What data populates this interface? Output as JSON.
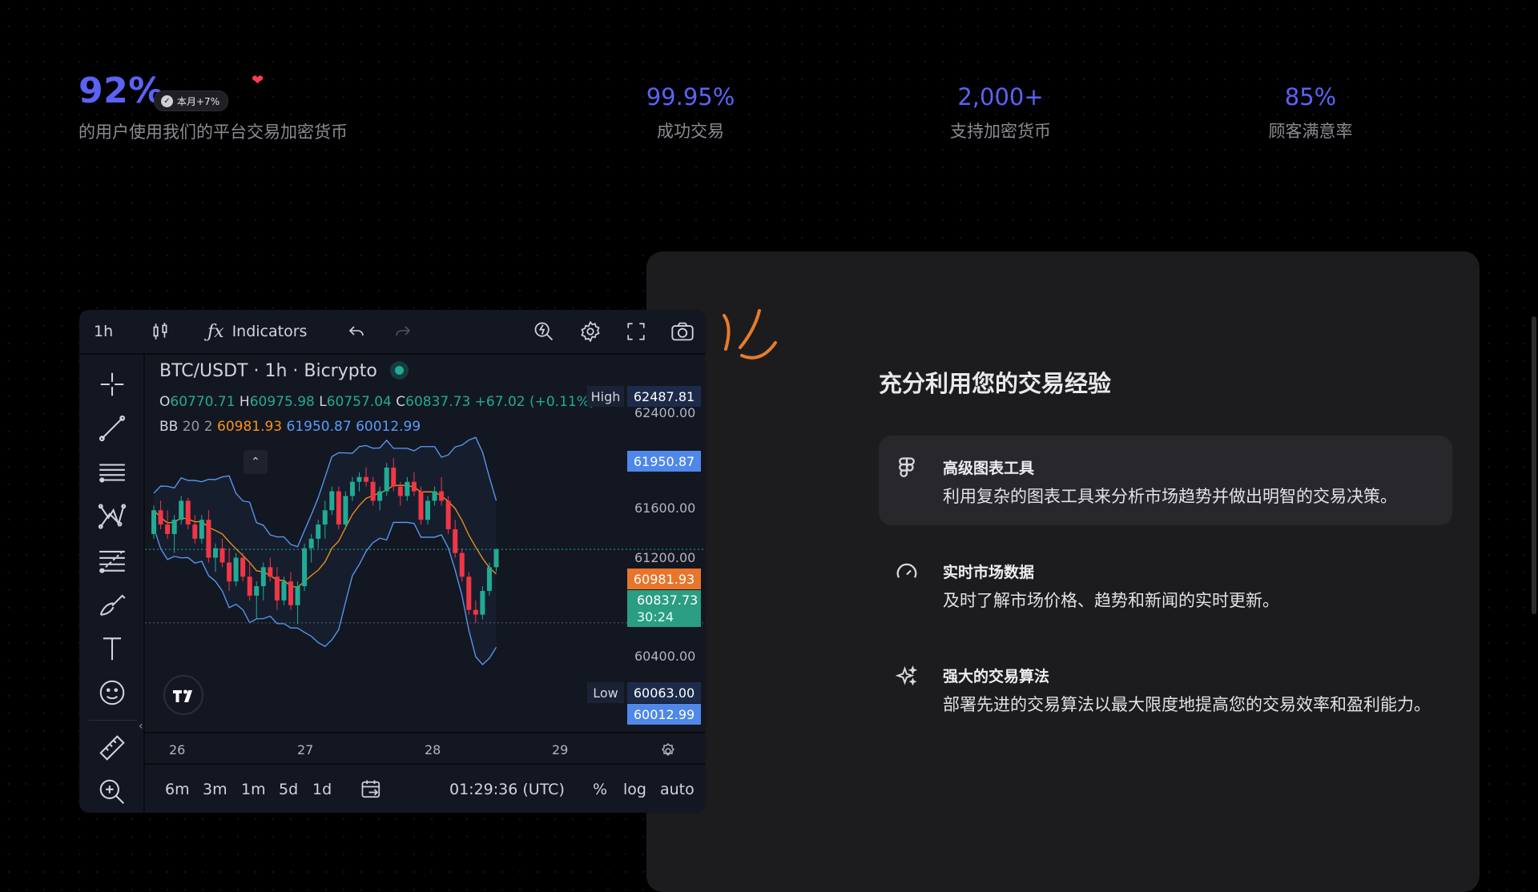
{
  "stats": {
    "main": {
      "value": "92%",
      "badge": "本月+7%",
      "label": "的用户使用我们的平台交易加密货币"
    },
    "items": [
      {
        "value": "99.95%",
        "label": "成功交易"
      },
      {
        "value": "2,000+",
        "label": "支持加密货币"
      },
      {
        "value": "85%",
        "label": "顾客满意率"
      }
    ]
  },
  "panel": {
    "title": "充分利用您的交易经验",
    "features": [
      {
        "title": "高级图表工具",
        "desc": "利用复杂的图表工具来分析市场趋势并做出明智的交易决策。",
        "icon": "figma-icon"
      },
      {
        "title": "实时市场数据",
        "desc": "及时了解市场价格、趋势和新闻的实时更新。",
        "icon": "gauge-icon"
      },
      {
        "title": "强大的交易算法",
        "desc": "部署先进的交易算法以最大限度地提高您的交易效率和盈利能力。",
        "icon": "sparkles-icon"
      }
    ]
  },
  "chart_widget": {
    "interval": "1h",
    "indicators_label": "Indicators",
    "symbol": "BTC/USDT · 1h · Bicrypto",
    "ohlc": {
      "o_label": "O",
      "o": "60770.71",
      "h_label": "H",
      "h": "60975.98",
      "l_label": "L",
      "l": "60757.04",
      "c_label": "C",
      "c": "60837.73",
      "change": "+67.02 (+0.11%)"
    },
    "bb": {
      "label": "BB",
      "params": "20 2",
      "basis": "60981.93",
      "upper": "61950.87",
      "lower": "60012.99"
    },
    "price_axis": [
      "62400.00",
      "61600.00",
      "61200.00",
      "60400.00"
    ],
    "tags": {
      "high_label": "High",
      "high": "62487.81",
      "upper": "61950.87",
      "basis": "60981.93",
      "last": "60837.73",
      "countdown": "30:24",
      "low_label": "Low",
      "low": "60063.00",
      "lower": "60012.99"
    },
    "time_axis": [
      "26",
      "27",
      "28",
      "29"
    ],
    "ranges": [
      "6m",
      "3m",
      "1m",
      "5d",
      "1d"
    ],
    "clock": "01:29:36 (UTC)",
    "scale_options": [
      "%",
      "log",
      "auto"
    ],
    "colors": {
      "up": "#22ab94",
      "down": "#f23645",
      "basis": "#f7931a",
      "bands": "#5b9cf6",
      "accent": "#5b63f5"
    }
  },
  "chart_data": {
    "type": "candlestick",
    "x_labels": [
      "26",
      "27",
      "28",
      "29"
    ],
    "y_ticks": [
      62400,
      61600,
      61200,
      60400
    ],
    "high_marker": 62487.81,
    "low_marker": 60063.0,
    "last_price": 60837.73,
    "bollinger": {
      "period": 20,
      "mult": 2,
      "basis": 60981.93,
      "upper": 61950.87,
      "lower": 60012.99
    },
    "candles": [
      [
        61000,
        61300,
        60950,
        61250
      ],
      [
        61250,
        61350,
        61050,
        61100
      ],
      [
        61100,
        61250,
        60950,
        61000
      ],
      [
        61000,
        61200,
        60800,
        61150
      ],
      [
        61150,
        61400,
        61100,
        61350
      ],
      [
        61350,
        61380,
        61050,
        61100
      ],
      [
        61100,
        61200,
        60900,
        60950
      ],
      [
        60950,
        61200,
        60900,
        61150
      ],
      [
        61150,
        61250,
        60700,
        60750
      ],
      [
        60750,
        60900,
        60600,
        60850
      ],
      [
        60850,
        60950,
        60650,
        60700
      ],
      [
        60700,
        60850,
        60400,
        60500
      ],
      [
        60500,
        60800,
        60450,
        60750
      ],
      [
        60750,
        60800,
        60500,
        60550
      ],
      [
        60550,
        60700,
        60300,
        60350
      ],
      [
        60350,
        60500,
        60100,
        60450
      ],
      [
        60450,
        60700,
        60300,
        60650
      ],
      [
        60650,
        60750,
        60500,
        60550
      ],
      [
        60550,
        60650,
        60200,
        60300
      ],
      [
        60300,
        60550,
        60250,
        60500
      ],
      [
        60500,
        60600,
        60200,
        60250
      ],
      [
        60250,
        60500,
        60050,
        60450
      ],
      [
        60450,
        60900,
        60400,
        60850
      ],
      [
        60850,
        61000,
        60700,
        60950
      ],
      [
        60950,
        61150,
        60850,
        61100
      ],
      [
        61100,
        61350,
        60950,
        61250
      ],
      [
        61250,
        61500,
        61200,
        61450
      ],
      [
        61450,
        61500,
        61050,
        61100
      ],
      [
        61100,
        61450,
        61050,
        61400
      ],
      [
        61400,
        61600,
        61350,
        61550
      ],
      [
        61550,
        61650,
        61450,
        61600
      ],
      [
        61600,
        61700,
        61500,
        61550
      ],
      [
        61550,
        61600,
        61300,
        61350
      ],
      [
        61350,
        61500,
        61250,
        61450
      ],
      [
        61450,
        61750,
        61400,
        61700
      ],
      [
        61700,
        61800,
        61450,
        61500
      ],
      [
        61500,
        61550,
        61300,
        61400
      ],
      [
        61400,
        61600,
        61350,
        61550
      ],
      [
        61550,
        61650,
        61400,
        61450
      ],
      [
        61450,
        61500,
        61100,
        61150
      ],
      [
        61150,
        61400,
        61100,
        61350
      ],
      [
        61350,
        61500,
        61300,
        61450
      ],
      [
        61450,
        61600,
        61300,
        61350
      ],
      [
        61350,
        61400,
        61000,
        61050
      ],
      [
        61050,
        61150,
        60750,
        60800
      ],
      [
        60800,
        60850,
        60500,
        60550
      ],
      [
        60550,
        60600,
        60150,
        60200
      ],
      [
        60200,
        60300,
        60063,
        60150
      ],
      [
        60150,
        60450,
        60100,
        60400
      ],
      [
        60400,
        60700,
        60350,
        60650
      ],
      [
        60650,
        60850,
        60600,
        60837.73
      ]
    ]
  }
}
